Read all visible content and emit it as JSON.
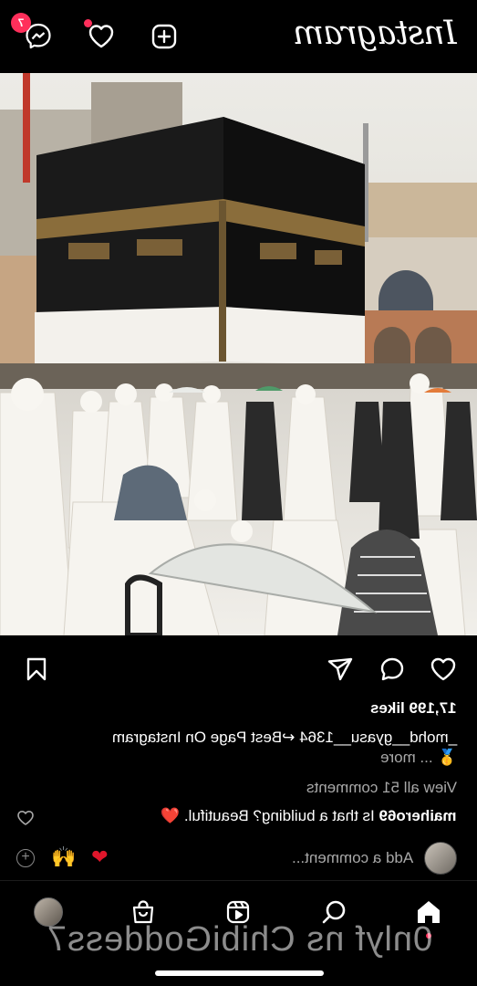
{
  "app": {
    "logo_text": "Instagram",
    "notification_count": "7"
  },
  "post": {
    "likes": "17,199 likes",
    "caption_line1": "_mohd__gyasu__1364 ↩Best Page On Instagram",
    "caption_line2": "🥇 ... more",
    "view_all_comments": "View all 51 comments",
    "comment_user": "maihero69",
    "comment_text": "Is that a building? Beautiful. ❤️",
    "heart_emoji": "❤",
    "add_comment_placeholder": "Add a comment...",
    "quick_emoji_1": "🙌",
    "quick_emoji_2": "❤"
  },
  "watermark": "0nlyf ns ChibiGoddess7",
  "icons": {
    "top": [
      "messenger-icon",
      "heart-icon",
      "plus-square-icon"
    ],
    "actions": [
      "bookmark-icon",
      "send-icon",
      "comment-icon",
      "like-icon"
    ],
    "nav": [
      "profile-avatar",
      "shop-icon",
      "reels-icon",
      "search-icon",
      "home-icon"
    ]
  },
  "colors": {
    "background": "#000000",
    "text": "#ffffff",
    "muted": "#a8a8a8",
    "badge": "#ff2f5b",
    "heart": "#e0162b"
  }
}
